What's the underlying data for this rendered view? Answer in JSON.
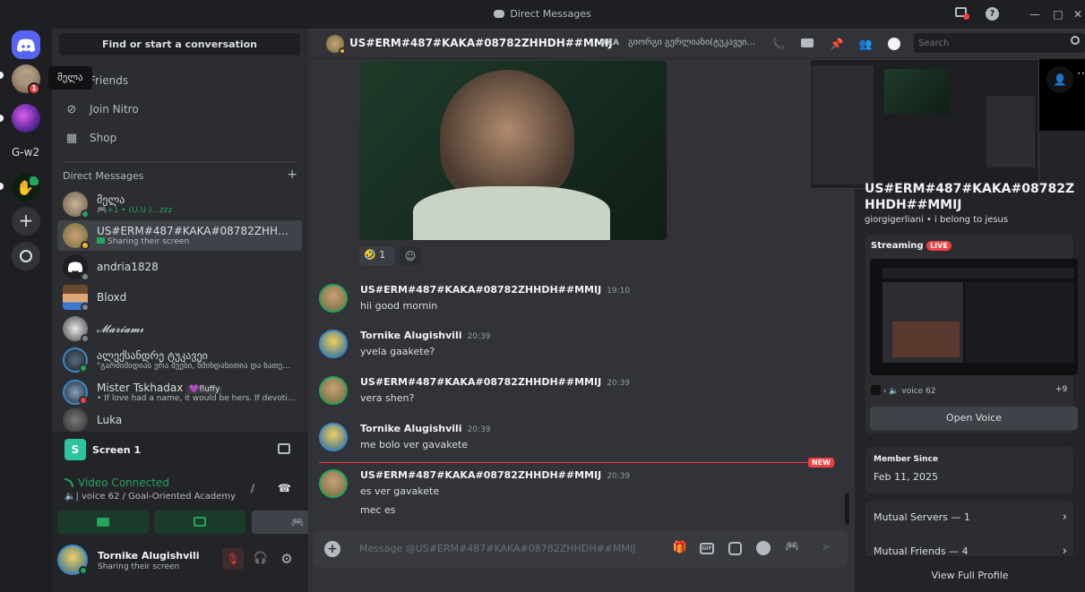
{
  "window": {
    "title": "Direct Messages"
  },
  "rail": {
    "tooltip": "მელა",
    "badge": "1",
    "folder_label": "G-w2"
  },
  "sidebar": {
    "search_label": "Find or start a conversation",
    "nav": [
      {
        "label": "Friends",
        "icon": "friends-icon"
      },
      {
        "label": "Join Nitro",
        "icon": "nitro-icon"
      },
      {
        "label": "Shop",
        "icon": "shop-icon"
      }
    ],
    "dm_header": "Direct Messages",
    "dm_add": "+",
    "dms": [
      {
        "name": "მელა",
        "sub": "🎮+1 • (U.U )...zzz"
      },
      {
        "name": "US#ERM#487#KAKA#08782ZHHDH...",
        "sub": "Sharing their screen"
      },
      {
        "name": "andria1828",
        "sub": ""
      },
      {
        "name": "Bloxd",
        "sub": ""
      },
      {
        "name": "𝓜𝓪𝓻𝓲𝓪𝓶𝓲",
        "sub": ""
      },
      {
        "name": "ალექსანდრე ტუკავეი",
        "sub": "\"გარმიმიდიას ერა შვენი, წმინდანითია და ნათელი..."
      },
      {
        "name": "Mister Tskhadax",
        "tag": "💜fluffy",
        "sub": "• If love had a name, it would be hers. If devotion..."
      },
      {
        "name": "Luka",
        "sub": ""
      }
    ]
  },
  "stream_panel": {
    "title": "Screen 1",
    "status": "Video Connected",
    "channel": "| voice 62 / Goal-Oriented Academy"
  },
  "user": {
    "name": "Tornike Alugishvili",
    "status": "Sharing their screen"
  },
  "chat": {
    "header_name": "US#ERM#487#KAKA#08782ZHHDH##MMIJ",
    "aka_label": "AKA",
    "aka_names": "გიორგი გერლიანი(ტუკავეი...",
    "search_placeholder": "Search",
    "reaction": {
      "emoji": "🤣",
      "count": "1"
    },
    "new_label": "NEW",
    "messages": [
      {
        "author": "US#ERM#487#KAKA#08782ZHHDH##MMIJ",
        "time": "19:10",
        "lines": [
          "hii good mornin"
        ],
        "av": "kitten"
      },
      {
        "author": "Tornike Alugishvili",
        "time": "20:39",
        "lines": [
          "yvela gaakete?"
        ],
        "av": "tornike"
      },
      {
        "author": "US#ERM#487#KAKA#08782ZHHDH##MMIJ",
        "time": "20:39",
        "lines": [
          "vera shen?"
        ],
        "av": "kitten"
      },
      {
        "author": "Tornike Alugishvili",
        "time": "20:39",
        "lines": [
          "me bolo ver gavakete"
        ],
        "av": "tornike"
      },
      {
        "author": "US#ERM#487#KAKA#08782ZHHDH##MMIJ",
        "time": "20:39",
        "lines": [
          "es ver gavakete",
          "mec es"
        ],
        "av": "kitten"
      }
    ],
    "composer_placeholder": "Message @US#ERM#487#KAKA#08782ZHHDH##MMIJ"
  },
  "profile": {
    "display_name": "US#ERM#487#KAKA#08782Z HHDH##MMIJ",
    "username": "giorgigerliani",
    "pronoun_note": "i belong to jesus",
    "streaming_label": "Streaming",
    "live_label": "LIVE",
    "voice_channel": "voice 62",
    "member_count": "+9",
    "open_voice": "Open Voice",
    "member_since_label": "Member Since",
    "member_since": "Feb 11, 2025",
    "mutual_servers": "Mutual Servers — 1",
    "mutual_friends": "Mutual Friends — 4",
    "view_full": "View Full Profile"
  },
  "colors": {
    "blurple": "#5865f2",
    "online": "#23a55a",
    "dnd": "#f23f43",
    "new_red": "#f23f43"
  }
}
